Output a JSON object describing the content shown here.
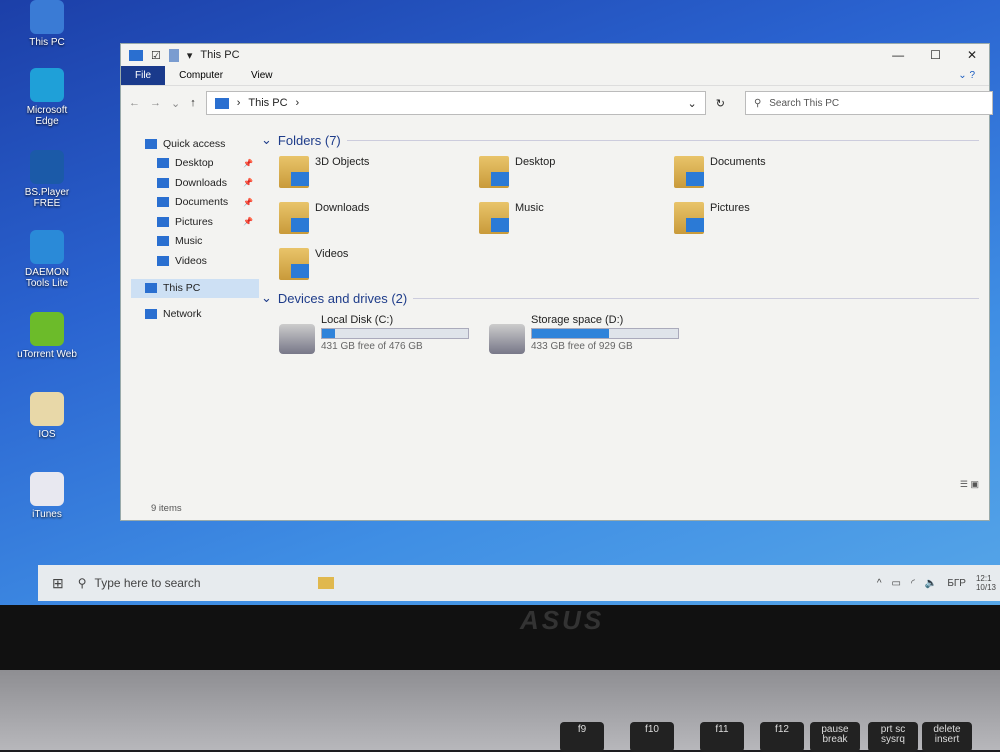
{
  "desktop": {
    "icons": [
      {
        "label": "This PC",
        "color": "#3a7bd5"
      },
      {
        "label": "Microsoft Edge",
        "color": "#1fa0d8"
      },
      {
        "label": "BS.Player FREE",
        "color": "#1b5aa8"
      },
      {
        "label": "DAEMON Tools Lite",
        "color": "#2a8ad8"
      },
      {
        "label": "uTorrent Web",
        "color": "#6cbb2a"
      },
      {
        "label": "IOS",
        "color": "#e8d8a8"
      },
      {
        "label": "iTunes",
        "color": "#e8e8f0"
      }
    ]
  },
  "window": {
    "title": "This PC",
    "ribbon_tabs": [
      "File",
      "Computer",
      "View"
    ],
    "address": {
      "crumb": "This PC",
      "search_placeholder": "Search This PC"
    },
    "nav": [
      {
        "label": "Quick access"
      },
      {
        "label": "Desktop",
        "pinned": true
      },
      {
        "label": "Downloads",
        "pinned": true
      },
      {
        "label": "Documents",
        "pinned": true
      },
      {
        "label": "Pictures",
        "pinned": true
      },
      {
        "label": "Music"
      },
      {
        "label": "Videos"
      },
      {
        "label": "This PC",
        "selected": true
      },
      {
        "label": "Network"
      }
    ],
    "folders_header": "Folders (7)",
    "folders": [
      "3D Objects",
      "Desktop",
      "Documents",
      "Downloads",
      "Music",
      "Pictures",
      "Videos"
    ],
    "drives_header": "Devices and drives (2)",
    "drives": [
      {
        "name": "Local Disk (C:)",
        "free": "431 GB free of 476 GB",
        "used_fraction": 0.09
      },
      {
        "name": "Storage space (D:)",
        "free": "433 GB free of 929 GB",
        "used_fraction": 0.53
      }
    ],
    "status": "9 items"
  },
  "taskbar": {
    "search_placeholder": "Type here to search",
    "lang": "БГР",
    "time": "12:1",
    "date": "10/13"
  },
  "laptop": {
    "brand": "ASUS",
    "keys": [
      "f9",
      "f10",
      "f11",
      "f12",
      "pause break",
      "prt sc sysrq",
      "delete insert"
    ]
  }
}
